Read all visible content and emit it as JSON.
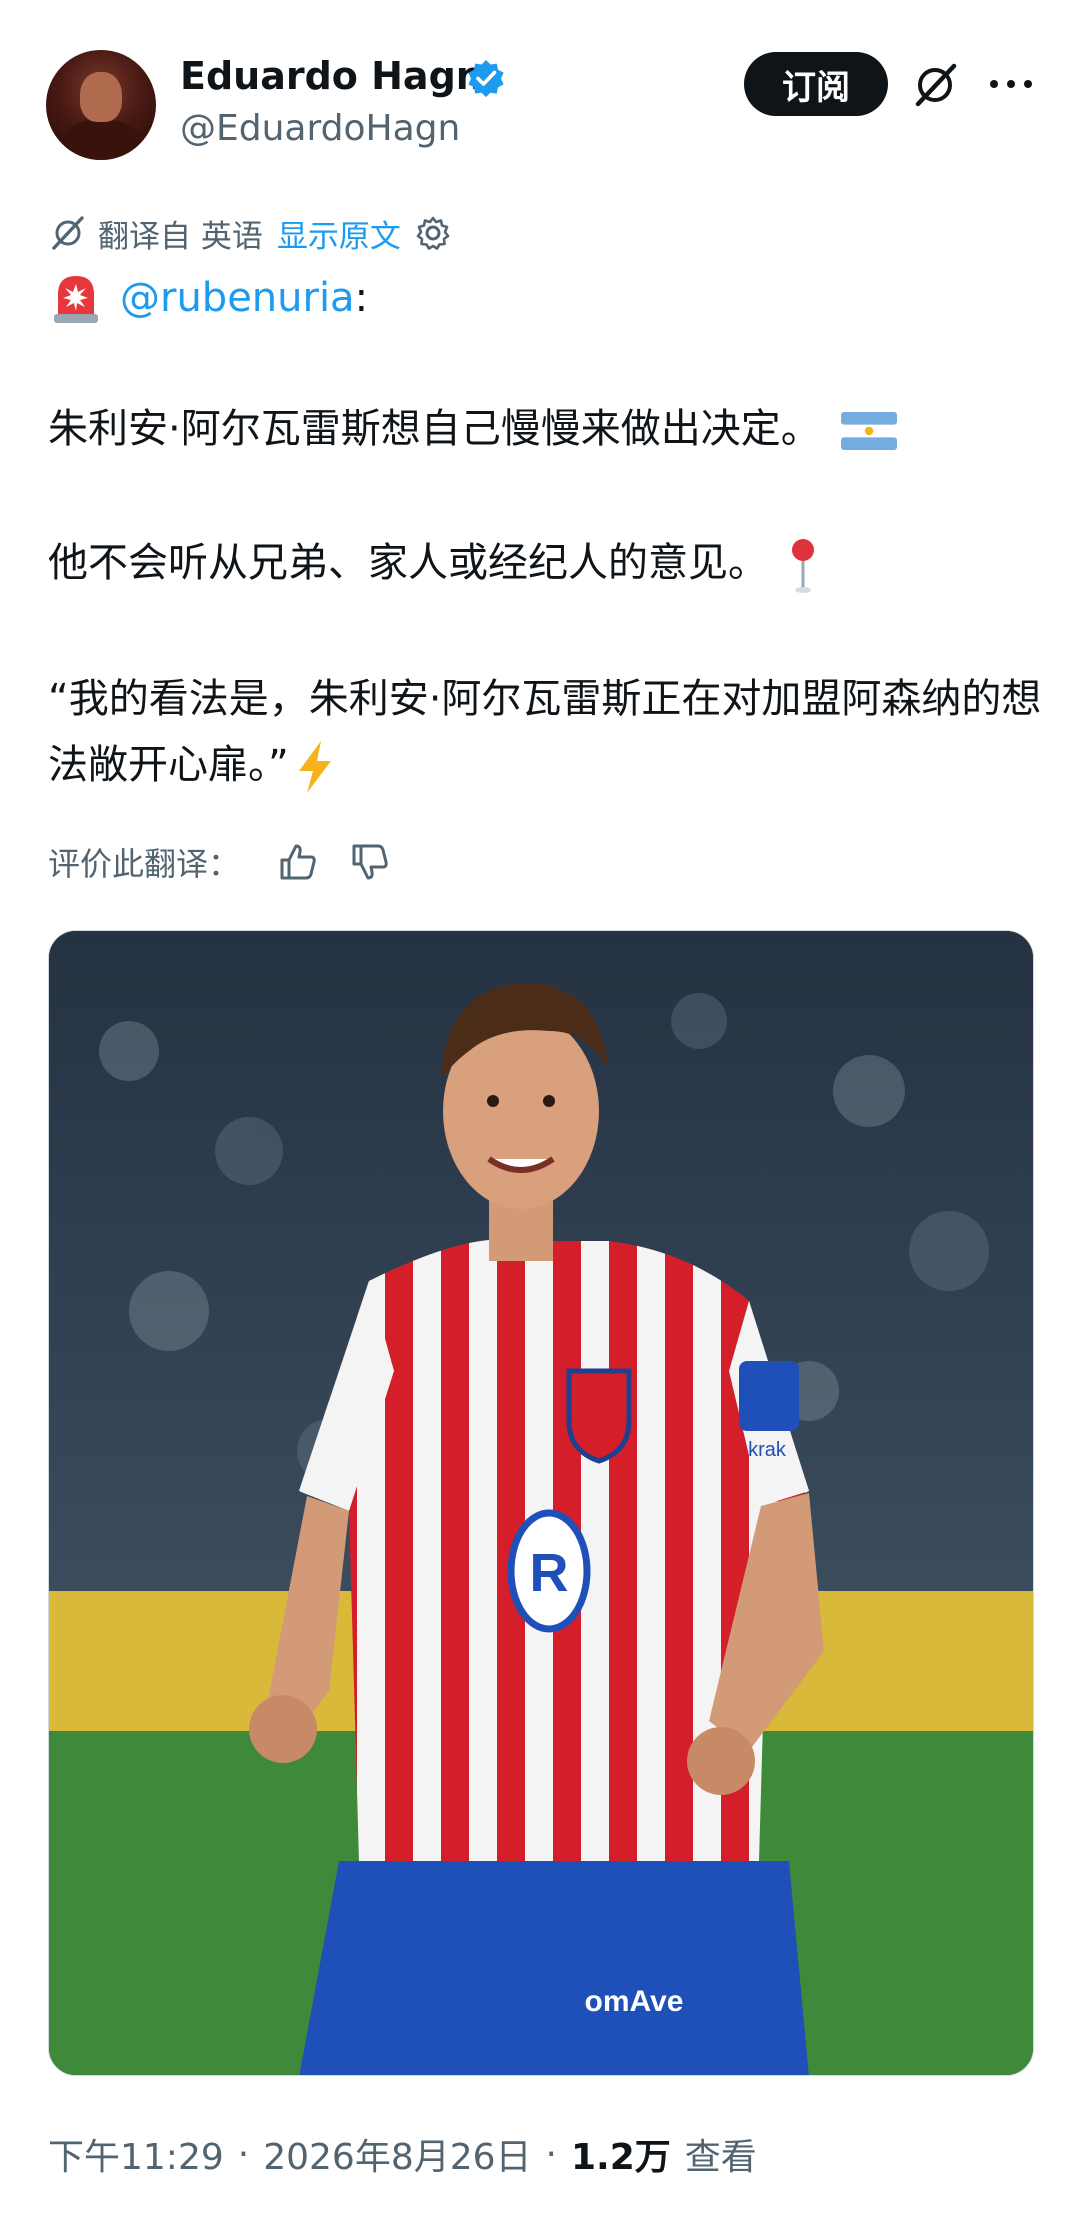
{
  "author": {
    "name": "Eduardo Hagn",
    "handle": "@EduardoHagn",
    "verified_color": "#1d9bf0"
  },
  "header_actions": {
    "subscribe_label": "订阅",
    "icons": [
      "grok-icon",
      "more-icon"
    ]
  },
  "translation": {
    "translated_from": "翻译自 英语",
    "show_original": "显示原文"
  },
  "tweet": {
    "mention": "@rubenuria",
    "colon": ":",
    "line1": "朱利安·阿尔瓦雷斯想自己慢慢来做出决定。",
    "line2": "他不会听从兄弟、家人或经纪人的意见。",
    "line3": "“我的看法是，朱利安·阿尔瓦雷斯正在对加盟阿森纳的想法敞开心扉。”"
  },
  "rating": {
    "label": "评价此翻译："
  },
  "photo": {
    "sponsor_sleeve": "krak",
    "shorts_text": "omAve"
  },
  "meta": {
    "time": "下午11:29",
    "date": "2026年8月26日",
    "views_count": "1.2万",
    "views_label": "查看"
  },
  "colors": {
    "accent": "#1d9bf0",
    "text": "#0f1419",
    "muted": "#536471"
  }
}
